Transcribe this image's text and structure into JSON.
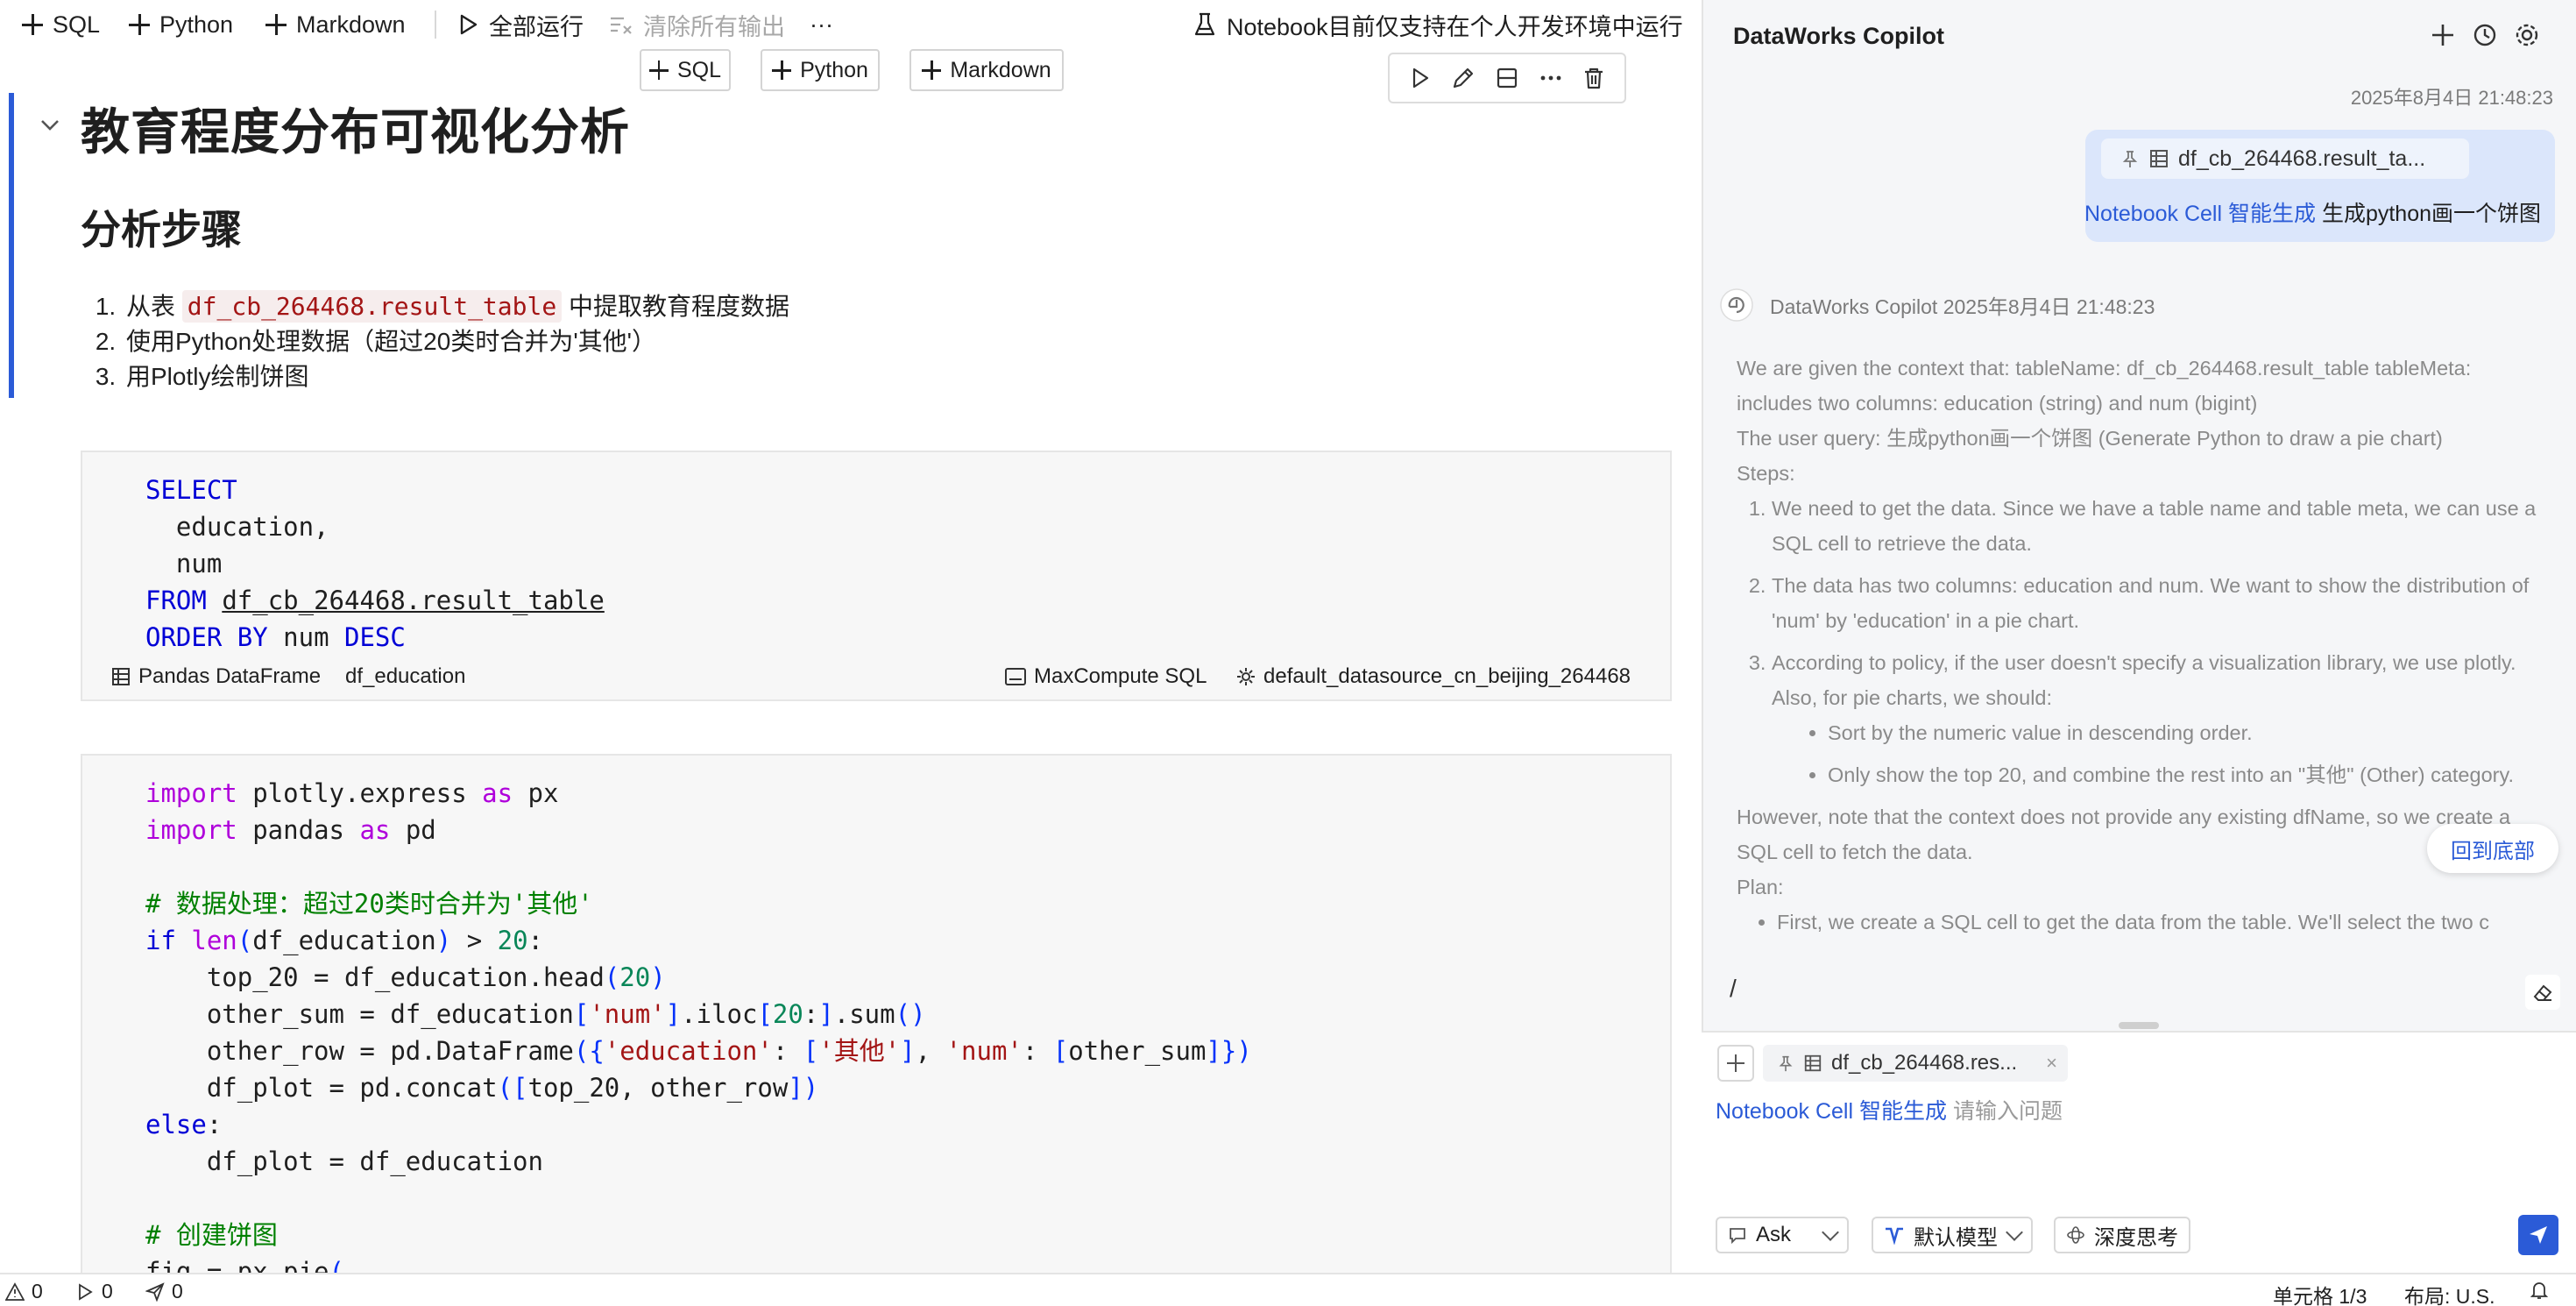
{
  "toolbar": {
    "sql": "SQL",
    "python": "Python",
    "markdown": "Markdown",
    "run_all": "全部运行",
    "clear_outputs": "清除所有输出",
    "more": "···",
    "notice": "Notebook目前仅支持在个人开发环境中运行"
  },
  "insert": {
    "sql": "SQL",
    "python": "Python",
    "markdown": "Markdown"
  },
  "markdown_cell": {
    "h1": "教育程度分布可视化分析",
    "h2": "分析步骤",
    "steps": [
      {
        "prefix": "从表 ",
        "code": "df_cb_264468.result_table",
        "suffix": " 中提取教育程度数据"
      },
      {
        "text": "使用Python处理数据（超过20类时合并为'其他'）"
      },
      {
        "text": "用Plotly绘制饼图"
      }
    ]
  },
  "sql_cell": {
    "select": "SELECT",
    "col1": "education,",
    "col2": "num",
    "from": "FROM",
    "table": "df_cb_264468.result_table",
    "order_by": "ORDER BY",
    "order_col": "num",
    "desc": "DESC",
    "output_type": "Pandas DataFrame",
    "output_var": "df_education",
    "engine": "MaxCompute SQL",
    "datasource": "default_datasource_cn_beijing_264468"
  },
  "copilot": {
    "title": "DataWorks Copilot",
    "user_timestamp": "2025年8月4日 21:48:23",
    "user_context_chip": "df_cb_264468.result_ta...",
    "user_msg_prefix": "Notebook Cell 智能生成",
    "user_msg": "生成python画一个饼图",
    "bot_header": "DataWorks Copilot 2025年8月4日 21:48:23",
    "bot_p1": "We are given the context that: tableName: df_cb_264468.result_table tableMeta: includes two columns: education (string) and num (bigint)",
    "bot_p2": "The user query: 生成python画一个饼图 (Generate Python to draw a pie chart)",
    "bot_p3": "Steps:",
    "bot_step1": "We need to get the data. Since we have a table name and table meta, we can use a SQL cell to retrieve the data.",
    "bot_step2": "The data has two columns: education and num. We want to show the distribution of 'num' by 'education' in a pie chart.",
    "bot_step3": "According to policy, if the user doesn't specify a visualization library, we use plotly. Also, for pie charts, we should:",
    "bot_sub1": "Sort by the numeric value in descending order.",
    "bot_sub2": "Only show the top 20, and combine the rest into an \"其他\" (Other) category.",
    "bot_p4": "However, note that the context does not provide any existing dfName, so we create a SQL cell to fetch the data.",
    "bot_p5": "Plan:",
    "bot_plan1": "First, we create a SQL cell to get the data from the table. We'll select the two c",
    "back_to_bottom": "回到底部",
    "slash": "/",
    "input_context_chip": "df_cb_264468.res...",
    "input_prefix": "Notebook Cell 智能生成",
    "input_placeholder": "请输入问题",
    "mode": "Ask",
    "model": "默认模型",
    "deep_think": "深度思考"
  },
  "status": {
    "warnings": "0",
    "runs": "0",
    "sends": "0",
    "cell_position": "单元格 1/3",
    "layout": "布局: U.S."
  }
}
